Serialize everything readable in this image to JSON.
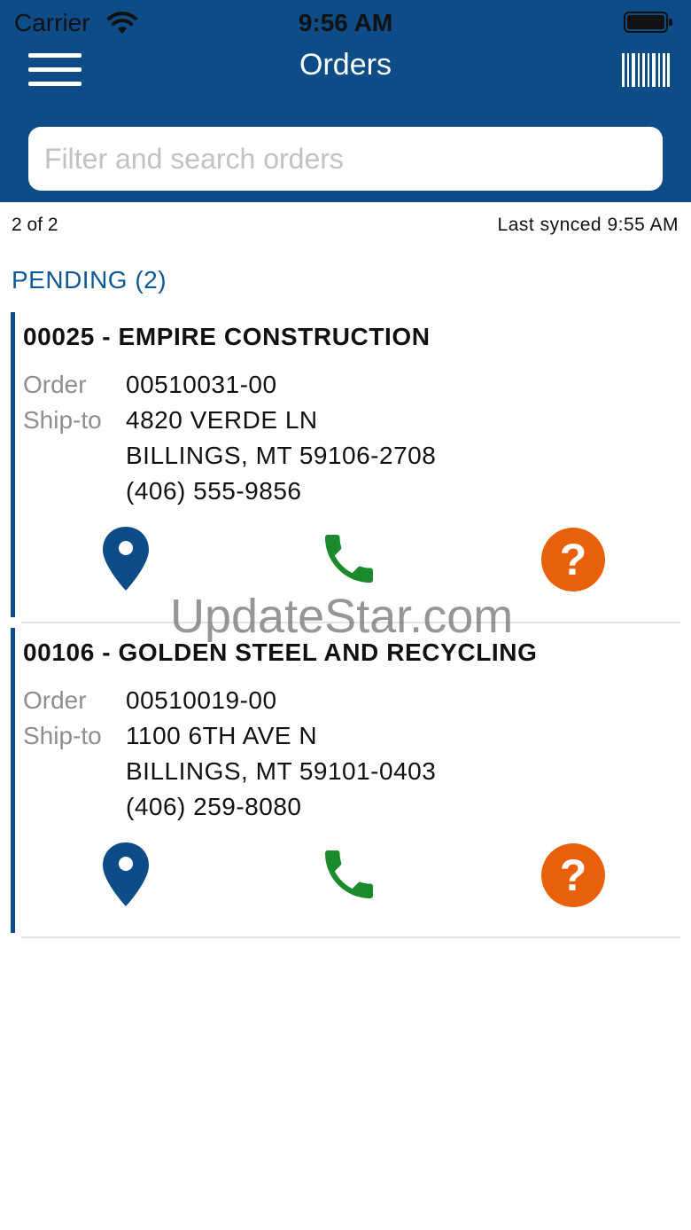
{
  "status_bar": {
    "carrier": "Carrier",
    "time": "9:56 AM"
  },
  "nav": {
    "title": "Orders"
  },
  "search": {
    "placeholder": "Filter and search orders"
  },
  "list_info": {
    "count": "2 of 2",
    "last_synced": "Last synced 9:55 AM"
  },
  "section": {
    "label": "PENDING (2)"
  },
  "orders": [
    {
      "title": "00025 - EMPIRE CONSTRUCTION",
      "order_label": "Order",
      "order_number": "00510031-00",
      "ship_label": "Ship-to",
      "address1": "4820 VERDE LN",
      "address2": "BILLINGS, MT 59106-2708",
      "phone": "(406) 555-9856"
    },
    {
      "title": "00106 - GOLDEN STEEL AND RECYCLING",
      "order_label": "Order",
      "order_number": "00510019-00",
      "ship_label": "Ship-to",
      "address1": "1100 6TH AVE N",
      "address2": "BILLINGS, MT 59101-0403",
      "phone": "(406) 259-8080"
    }
  ],
  "watermark": "UpdateStar.com",
  "colors": {
    "header": "#0d4c86",
    "section": "#0d5a97",
    "location_icon": "#0d4c86",
    "phone_icon": "#1a8a2a",
    "help_icon": "#e8600a"
  },
  "icons": [
    "menu-icon",
    "barcode-icon",
    "location-pin-icon",
    "phone-icon",
    "help-icon",
    "wifi-icon",
    "battery-icon"
  ]
}
